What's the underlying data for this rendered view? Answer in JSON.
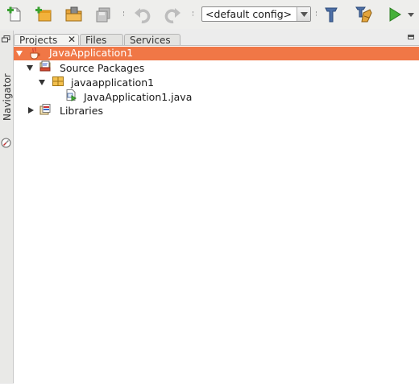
{
  "toolbar": {
    "buttons": [
      {
        "name": "new-file-icon"
      },
      {
        "name": "new-project-icon"
      },
      {
        "name": "open-project-icon"
      },
      {
        "name": "save-all-icon"
      },
      {
        "name": "undo-icon"
      },
      {
        "name": "redo-icon"
      },
      {
        "name": "build-icon"
      },
      {
        "name": "clean-build-icon"
      },
      {
        "name": "run-icon"
      }
    ],
    "config_value": "<default config>"
  },
  "navigator": {
    "label": "Navigator"
  },
  "tabs": [
    {
      "label": "Projects",
      "active": true,
      "closable": true
    },
    {
      "label": "Files",
      "active": false
    },
    {
      "label": "Services",
      "active": false
    }
  ],
  "tree": {
    "items": [
      {
        "label": "JavaApplication1",
        "icon": "java-project-icon",
        "expanded": true,
        "selected": true
      },
      {
        "label": "Source Packages",
        "icon": "source-packages-icon",
        "expanded": true
      },
      {
        "label": "javaapplication1",
        "icon": "package-icon",
        "expanded": true
      },
      {
        "label": "JavaApplication1.java",
        "icon": "java-file-icon"
      },
      {
        "label": "Libraries",
        "icon": "libraries-icon",
        "expanded": false
      }
    ]
  },
  "colors": {
    "selection": "#f07746",
    "toolbar_bg": "#eeeeec",
    "tree_bg": "#ffffff"
  }
}
